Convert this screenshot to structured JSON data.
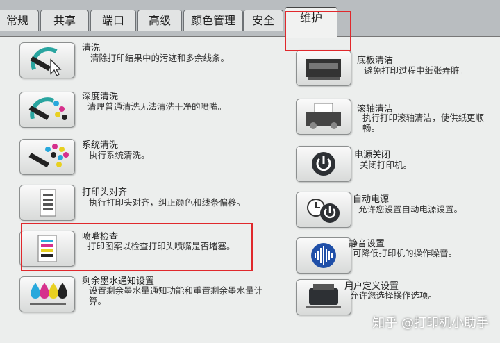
{
  "tabs": [
    {
      "label": "常规"
    },
    {
      "label": "共享"
    },
    {
      "label": "端口"
    },
    {
      "label": "高级"
    },
    {
      "label": "颜色管理"
    },
    {
      "label": "安全"
    },
    {
      "label": "维护"
    }
  ],
  "left_items": [
    {
      "title": "清洗",
      "desc": "清除打印结果中的污迹和多余线条。"
    },
    {
      "title": "深度清洗",
      "desc": "清理普通清洗无法清洗干净的喷嘴。"
    },
    {
      "title": "系统清洗",
      "desc": "执行系统清洗。"
    },
    {
      "title": "打印头对齐",
      "desc": "执行打印头对齐，纠正颜色和线条偏移。"
    },
    {
      "title": "喷嘴检查",
      "desc": "打印图案以检查打印头喷嘴是否堵塞。"
    },
    {
      "title": "剩余墨水通知设置",
      "desc": "设置剩余墨水量通知功能和重置剩余墨水量计算。"
    }
  ],
  "right_items": [
    {
      "title": "底板清洁",
      "desc": "避免打印过程中纸张弄脏。"
    },
    {
      "title": "滚轴清洁",
      "desc": "执行打印滚轴清洁，使供纸更顺畅。"
    },
    {
      "title": "电源关闭",
      "desc": "关闭打印机。"
    },
    {
      "title": "自动电源",
      "desc": "允许您设置自动电源设置。"
    },
    {
      "title": "静音设置",
      "desc": "可降低打印机的操作噪音。"
    },
    {
      "title": "用户定义设置",
      "desc": "允许您选择操作选项。"
    }
  ],
  "watermark": "知乎 @打印机小助手",
  "colors": {
    "highlight": "#e0282c",
    "panel": "#eceeed"
  }
}
